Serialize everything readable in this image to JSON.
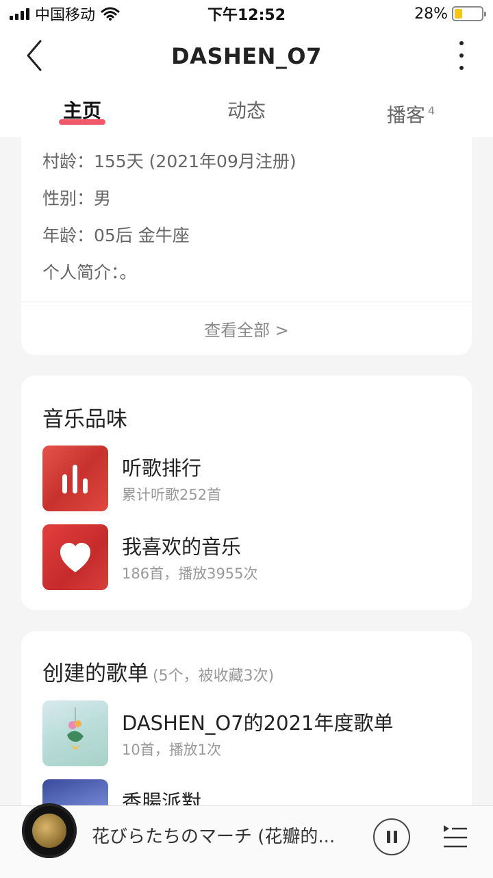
{
  "status_bar": {
    "carrier": "中国移动",
    "time": "下午12:52",
    "battery": "28%",
    "battery_level": 0.28
  },
  "nav": {
    "title": "DASHEN_O7"
  },
  "tabs": [
    {
      "label": "主页",
      "active": true
    },
    {
      "label": "动态",
      "active": false
    },
    {
      "label": "播客",
      "badge": "4",
      "active": false
    }
  ],
  "info": {
    "village_age": "村龄：155天 (2021年09月注册)",
    "gender": "性别：男",
    "age": "年龄：05后 金牛座",
    "bio": "个人简介：。",
    "view_all": "查看全部 >"
  },
  "taste": {
    "title": "音乐品味",
    "items": [
      {
        "title": "听歌排行",
        "sub": "累计听歌252首",
        "icon": "bar-chart-icon"
      },
      {
        "title": "我喜欢的音乐",
        "sub": "186首，播放3955次",
        "icon": "heart-icon"
      }
    ]
  },
  "playlists": {
    "title": "创建的歌单",
    "count": "(5个，被收藏3次)",
    "items": [
      {
        "title": "DASHEN_O7的2021年度歌单",
        "sub": "10首，播放1次"
      },
      {
        "title": "香腸派對",
        "sub": ""
      }
    ]
  },
  "player": {
    "song": "花びらたちのマーチ (花瓣的..."
  }
}
